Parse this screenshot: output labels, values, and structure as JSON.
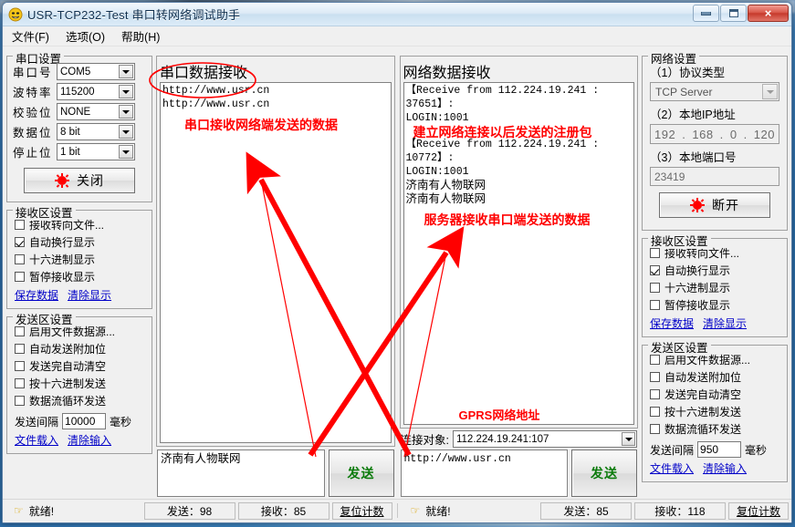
{
  "window": {
    "title": "USR-TCP232-Test 串口转网络调试助手",
    "icon": "app-face-icon",
    "minimize": "minimize-icon",
    "maximize": "maximize-icon",
    "close": "×"
  },
  "menu": [
    {
      "label": "文件(F)"
    },
    {
      "label": "选项(O)"
    },
    {
      "label": "帮助(H)"
    }
  ],
  "serial_settings": {
    "legend": "串口设置",
    "fields": [
      {
        "label": "串口号",
        "value": "COM5"
      },
      {
        "label": "波特率",
        "value": "115200"
      },
      {
        "label": "校验位",
        "value": "NONE"
      },
      {
        "label": "数据位",
        "value": "8 bit"
      },
      {
        "label": "停止位",
        "value": "1 bit"
      }
    ],
    "button": "关闭"
  },
  "serial_recv_settings": {
    "legend": "接收区设置",
    "checkboxes": [
      {
        "label": "接收转向文件...",
        "checked": false
      },
      {
        "label": "自动换行显示",
        "checked": true
      },
      {
        "label": "十六进制显示",
        "checked": false
      },
      {
        "label": "暂停接收显示",
        "checked": false
      }
    ],
    "links": [
      "保存数据",
      "清除显示"
    ]
  },
  "serial_send_settings": {
    "legend": "发送区设置",
    "checkboxes": [
      {
        "label": "启用文件数据源...",
        "checked": false
      },
      {
        "label": "自动发送附加位",
        "checked": false
      },
      {
        "label": "发送完自动清空",
        "checked": false
      },
      {
        "label": "按十六进制发送",
        "checked": false
      },
      {
        "label": "数据流循环发送",
        "checked": false
      }
    ],
    "interval_label": "发送间隔",
    "interval_value": "10000",
    "interval_unit": "毫秒",
    "links": [
      "文件载入",
      "清除输入"
    ]
  },
  "serial_data": {
    "legend": "串口数据接收",
    "lines": [
      {
        "text": "http://www.usr.cn",
        "style": "mono"
      },
      {
        "text": "http://www.usr.cn",
        "style": "mono"
      }
    ],
    "annotation": "串口接收网络端发送的数据",
    "send_value": "济南有人物联网",
    "send_button": "发送"
  },
  "network_data": {
    "legend": "网络数据接收",
    "lines": [
      {
        "text": "【Receive from 112.224.19.241 : 37651】:",
        "style": "mono"
      },
      {
        "text": "LOGIN:1001",
        "style": "mono"
      },
      {
        "text": "建立网络连接以后发送的注册包",
        "style": "annotation"
      },
      {
        "text": "【Receive from 112.224.19.241 : 10772】:",
        "style": "mono"
      },
      {
        "text": "LOGIN:1001",
        "style": "mono"
      },
      {
        "text": "济南有人物联网",
        "style": "zh"
      },
      {
        "text": "济南有人物联网",
        "style": "zh"
      },
      {
        "text": "服务器接收串口端发送的数据",
        "style": "annotation"
      }
    ],
    "gprs_label": "GPRS网络地址",
    "target_label": "连接对象:",
    "target_value": "112.224.19.241:107",
    "send_value": "http://www.usr.cn",
    "send_button": "发送"
  },
  "network_settings": {
    "legend": "网络设置",
    "protocol_label": "（1）协议类型",
    "protocol_value": "TCP Server",
    "ip_label": "（2）本地IP地址",
    "ip_octets": [
      "192",
      "168",
      "0",
      "120"
    ],
    "port_label": "（3）本地端口号",
    "port_value": "23419",
    "button": "断开"
  },
  "network_recv_settings": {
    "legend": "接收区设置",
    "checkboxes": [
      {
        "label": "接收转向文件...",
        "checked": false
      },
      {
        "label": "自动换行显示",
        "checked": true
      },
      {
        "label": "十六进制显示",
        "checked": false
      },
      {
        "label": "暂停接收显示",
        "checked": false
      }
    ],
    "links": [
      "保存数据",
      "清除显示"
    ]
  },
  "network_send_settings": {
    "legend": "发送区设置",
    "checkboxes": [
      {
        "label": "启用文件数据源...",
        "checked": false
      },
      {
        "label": "自动发送附加位",
        "checked": false
      },
      {
        "label": "发送完自动清空",
        "checked": false
      },
      {
        "label": "按十六进制发送",
        "checked": false
      },
      {
        "label": "数据流循环发送",
        "checked": false
      }
    ],
    "interval_label": "发送间隔",
    "interval_value": "950",
    "interval_unit": "毫秒",
    "links": [
      "文件载入",
      "清除输入"
    ]
  },
  "status_left": {
    "ready": "就绪!",
    "sent": "发送：98",
    "recv": "接收：85",
    "reset": "复位计数"
  },
  "status_right": {
    "ready": "就绪!",
    "sent": "发送：85",
    "recv": "接收：118",
    "reset": "复位计数"
  },
  "colors": {
    "annotation_red": "#ff0000",
    "link_blue": "#0000c8",
    "send_green": "#0a7a0a"
  }
}
